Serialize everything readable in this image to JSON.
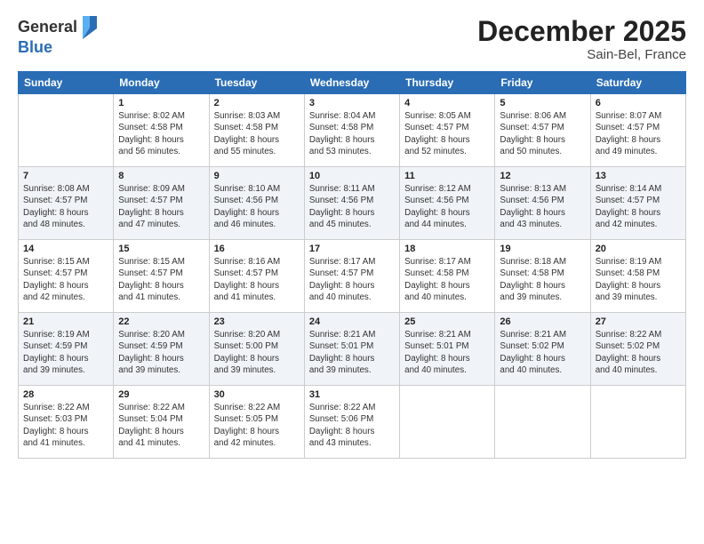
{
  "header": {
    "logo_general": "General",
    "logo_blue": "Blue",
    "month_title": "December 2025",
    "location": "Sain-Bel, France"
  },
  "days_of_week": [
    "Sunday",
    "Monday",
    "Tuesday",
    "Wednesday",
    "Thursday",
    "Friday",
    "Saturday"
  ],
  "weeks": [
    [
      {
        "day": "",
        "info": ""
      },
      {
        "day": "1",
        "info": "Sunrise: 8:02 AM\nSunset: 4:58 PM\nDaylight: 8 hours\nand 56 minutes."
      },
      {
        "day": "2",
        "info": "Sunrise: 8:03 AM\nSunset: 4:58 PM\nDaylight: 8 hours\nand 55 minutes."
      },
      {
        "day": "3",
        "info": "Sunrise: 8:04 AM\nSunset: 4:58 PM\nDaylight: 8 hours\nand 53 minutes."
      },
      {
        "day": "4",
        "info": "Sunrise: 8:05 AM\nSunset: 4:57 PM\nDaylight: 8 hours\nand 52 minutes."
      },
      {
        "day": "5",
        "info": "Sunrise: 8:06 AM\nSunset: 4:57 PM\nDaylight: 8 hours\nand 50 minutes."
      },
      {
        "day": "6",
        "info": "Sunrise: 8:07 AM\nSunset: 4:57 PM\nDaylight: 8 hours\nand 49 minutes."
      }
    ],
    [
      {
        "day": "7",
        "info": "Sunrise: 8:08 AM\nSunset: 4:57 PM\nDaylight: 8 hours\nand 48 minutes."
      },
      {
        "day": "8",
        "info": "Sunrise: 8:09 AM\nSunset: 4:57 PM\nDaylight: 8 hours\nand 47 minutes."
      },
      {
        "day": "9",
        "info": "Sunrise: 8:10 AM\nSunset: 4:56 PM\nDaylight: 8 hours\nand 46 minutes."
      },
      {
        "day": "10",
        "info": "Sunrise: 8:11 AM\nSunset: 4:56 PM\nDaylight: 8 hours\nand 45 minutes."
      },
      {
        "day": "11",
        "info": "Sunrise: 8:12 AM\nSunset: 4:56 PM\nDaylight: 8 hours\nand 44 minutes."
      },
      {
        "day": "12",
        "info": "Sunrise: 8:13 AM\nSunset: 4:56 PM\nDaylight: 8 hours\nand 43 minutes."
      },
      {
        "day": "13",
        "info": "Sunrise: 8:14 AM\nSunset: 4:57 PM\nDaylight: 8 hours\nand 42 minutes."
      }
    ],
    [
      {
        "day": "14",
        "info": "Sunrise: 8:15 AM\nSunset: 4:57 PM\nDaylight: 8 hours\nand 42 minutes."
      },
      {
        "day": "15",
        "info": "Sunrise: 8:15 AM\nSunset: 4:57 PM\nDaylight: 8 hours\nand 41 minutes."
      },
      {
        "day": "16",
        "info": "Sunrise: 8:16 AM\nSunset: 4:57 PM\nDaylight: 8 hours\nand 41 minutes."
      },
      {
        "day": "17",
        "info": "Sunrise: 8:17 AM\nSunset: 4:57 PM\nDaylight: 8 hours\nand 40 minutes."
      },
      {
        "day": "18",
        "info": "Sunrise: 8:17 AM\nSunset: 4:58 PM\nDaylight: 8 hours\nand 40 minutes."
      },
      {
        "day": "19",
        "info": "Sunrise: 8:18 AM\nSunset: 4:58 PM\nDaylight: 8 hours\nand 39 minutes."
      },
      {
        "day": "20",
        "info": "Sunrise: 8:19 AM\nSunset: 4:58 PM\nDaylight: 8 hours\nand 39 minutes."
      }
    ],
    [
      {
        "day": "21",
        "info": "Sunrise: 8:19 AM\nSunset: 4:59 PM\nDaylight: 8 hours\nand 39 minutes."
      },
      {
        "day": "22",
        "info": "Sunrise: 8:20 AM\nSunset: 4:59 PM\nDaylight: 8 hours\nand 39 minutes."
      },
      {
        "day": "23",
        "info": "Sunrise: 8:20 AM\nSunset: 5:00 PM\nDaylight: 8 hours\nand 39 minutes."
      },
      {
        "day": "24",
        "info": "Sunrise: 8:21 AM\nSunset: 5:01 PM\nDaylight: 8 hours\nand 39 minutes."
      },
      {
        "day": "25",
        "info": "Sunrise: 8:21 AM\nSunset: 5:01 PM\nDaylight: 8 hours\nand 40 minutes."
      },
      {
        "day": "26",
        "info": "Sunrise: 8:21 AM\nSunset: 5:02 PM\nDaylight: 8 hours\nand 40 minutes."
      },
      {
        "day": "27",
        "info": "Sunrise: 8:22 AM\nSunset: 5:02 PM\nDaylight: 8 hours\nand 40 minutes."
      }
    ],
    [
      {
        "day": "28",
        "info": "Sunrise: 8:22 AM\nSunset: 5:03 PM\nDaylight: 8 hours\nand 41 minutes."
      },
      {
        "day": "29",
        "info": "Sunrise: 8:22 AM\nSunset: 5:04 PM\nDaylight: 8 hours\nand 41 minutes."
      },
      {
        "day": "30",
        "info": "Sunrise: 8:22 AM\nSunset: 5:05 PM\nDaylight: 8 hours\nand 42 minutes."
      },
      {
        "day": "31",
        "info": "Sunrise: 8:22 AM\nSunset: 5:06 PM\nDaylight: 8 hours\nand 43 minutes."
      },
      {
        "day": "",
        "info": ""
      },
      {
        "day": "",
        "info": ""
      },
      {
        "day": "",
        "info": ""
      }
    ]
  ]
}
